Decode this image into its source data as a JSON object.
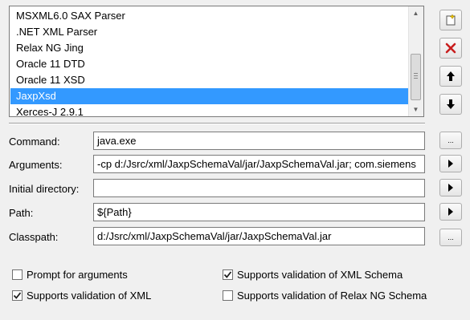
{
  "list": {
    "items": [
      "MSXML6.0 SAX Parser",
      ".NET XML Parser",
      "Relax NG Jing",
      "Oracle 11 DTD",
      "Oracle 11 XSD",
      "JaxpXsd",
      "Xerces-J 2.9.1"
    ],
    "selected": "JaxpXsd"
  },
  "fields": {
    "command": {
      "label": "Command:",
      "value": "java.exe",
      "button": "..."
    },
    "arguments": {
      "label": "Arguments:",
      "value": "-cp d:/Jsrc/xml/JaxpSchemaVal/jar/JaxpSchemaVal.jar; com.siemens"
    },
    "initial_directory": {
      "label": "Initial directory:",
      "value": ""
    },
    "path": {
      "label": "Path:",
      "value": "${Path}"
    },
    "classpath": {
      "label": "Classpath:",
      "value": "d:/Jsrc/xml/JaxpSchemaVal/jar/JaxpSchemaVal.jar",
      "button": "..."
    }
  },
  "options": {
    "prompt_for_arguments": {
      "label": "Prompt for arguments",
      "checked": false
    },
    "supports_xml": {
      "label": "Supports validation of XML",
      "checked": true
    },
    "supports_xml_schema": {
      "label": "Supports validation of XML Schema",
      "checked": true
    },
    "supports_relax_ng": {
      "label": "Supports validation of Relax NG Schema",
      "checked": false
    }
  },
  "icons": {
    "new": "new-item-icon",
    "delete": "delete-x-icon",
    "up": "move-up-arrow-icon",
    "down": "move-down-arrow-icon",
    "delete_color": "#c81e1e"
  }
}
